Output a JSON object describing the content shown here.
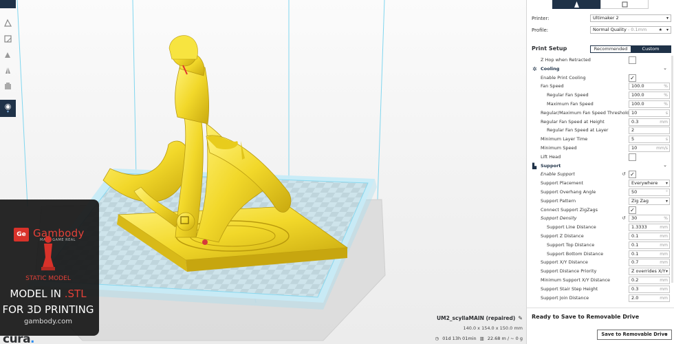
{
  "sidebar": {
    "printer_label": "Printer:",
    "printer_value": "Ultimaker 2",
    "profile_label": "Profile:",
    "profile_value": "Normal Quality",
    "profile_sub": " - 0.1mm",
    "print_setup_title": "Print Setup",
    "mode_recommended": "Recommended",
    "mode_custom": "Custom",
    "settings": [
      {
        "label": "Z Hop when Retracted",
        "indent": 1,
        "kind": "check",
        "checked": false
      },
      {
        "label": "Cooling",
        "kind": "category",
        "icon": "fan-icon"
      },
      {
        "label": "Enable Print Cooling",
        "indent": 1,
        "kind": "check",
        "checked": true
      },
      {
        "label": "Fan Speed",
        "indent": 1,
        "kind": "text",
        "value": "100.0",
        "unit": "%"
      },
      {
        "label": "Regular Fan Speed",
        "indent": 2,
        "kind": "text",
        "value": "100.0",
        "unit": "%"
      },
      {
        "label": "Maximum Fan Speed",
        "indent": 2,
        "kind": "text",
        "value": "100.0",
        "unit": "%"
      },
      {
        "label": "Regular/Maximum Fan Speed Threshold",
        "indent": 1,
        "kind": "text",
        "value": "10",
        "unit": "s"
      },
      {
        "label": "Regular Fan Speed at Height",
        "indent": 1,
        "kind": "text",
        "value": "0.3",
        "unit": "mm"
      },
      {
        "label": "Regular Fan Speed at Layer",
        "indent": 2,
        "kind": "text",
        "value": "2",
        "unit": ""
      },
      {
        "label": "Minimum Layer Time",
        "indent": 1,
        "kind": "text",
        "value": "5",
        "unit": "s"
      },
      {
        "label": "Minimum Speed",
        "indent": 1,
        "kind": "text",
        "value": "10",
        "unit": "mm/s"
      },
      {
        "label": "Lift Head",
        "indent": 1,
        "kind": "check",
        "checked": false
      },
      {
        "label": "Support",
        "kind": "category",
        "icon": "support-icon"
      },
      {
        "label": "Enable Support",
        "indent": 1,
        "kind": "check",
        "checked": true,
        "italic": true,
        "reset": true
      },
      {
        "label": "Support Placement",
        "indent": 1,
        "kind": "drop",
        "value": "Everywhere"
      },
      {
        "label": "Support Overhang Angle",
        "indent": 1,
        "kind": "text",
        "value": "50",
        "unit": "°"
      },
      {
        "label": "Support Pattern",
        "indent": 1,
        "kind": "drop",
        "value": "Zig Zag"
      },
      {
        "label": "Connect Support ZigZags",
        "indent": 1,
        "kind": "check",
        "checked": true
      },
      {
        "label": "Support Density",
        "indent": 1,
        "kind": "text",
        "value": "30",
        "unit": "%",
        "italic": true,
        "reset": true
      },
      {
        "label": "Support Line Distance",
        "indent": 2,
        "kind": "text",
        "value": "1.3333",
        "unit": "mm"
      },
      {
        "label": "Support Z Distance",
        "indent": 1,
        "kind": "text",
        "value": "0.1",
        "unit": "mm"
      },
      {
        "label": "Support Top Distance",
        "indent": 2,
        "kind": "text",
        "value": "0.1",
        "unit": "mm"
      },
      {
        "label": "Support Bottom Distance",
        "indent": 2,
        "kind": "text",
        "value": "0.1",
        "unit": "mm"
      },
      {
        "label": "Support X/Y Distance",
        "indent": 1,
        "kind": "text",
        "value": "0.7",
        "unit": "mm"
      },
      {
        "label": "Support Distance Priority",
        "indent": 1,
        "kind": "drop",
        "value": "Z overrides X/Y"
      },
      {
        "label": "Minimum Support X/Y Distance",
        "indent": 1,
        "kind": "text",
        "value": "0.2",
        "unit": "mm"
      },
      {
        "label": "Support Stair Step Height",
        "indent": 1,
        "kind": "text",
        "value": "0.3",
        "unit": "mm"
      },
      {
        "label": "Support Join Distance",
        "indent": 1,
        "kind": "text",
        "value": "2.0",
        "unit": "mm"
      }
    ],
    "ready_text": "Ready to Save to Removable Drive",
    "save_button": "Save to Removable Drive"
  },
  "job": {
    "name": "UM2_scyllaMAIN (repaired)",
    "dims": "140.0 x 154.0 x 150.0 mm",
    "time": "01d 13h 01min",
    "material": "22.68 m / ~ 0 g"
  },
  "watermark": {
    "logo_letters": "Ge",
    "brand": "Gambody",
    "tagline": "MAKE GAME REAL",
    "static_model": "STATIC MODEL",
    "model_in": "MODEL IN ",
    "stl": ".STL",
    "for_3d": "FOR 3D PRINTING",
    "site": "gambody.com"
  },
  "app": {
    "logo": "cura",
    "logo_dot": "."
  },
  "colors": {
    "accent": "#1f3248",
    "model": "#f5e135",
    "brand_red": "#e34138"
  }
}
